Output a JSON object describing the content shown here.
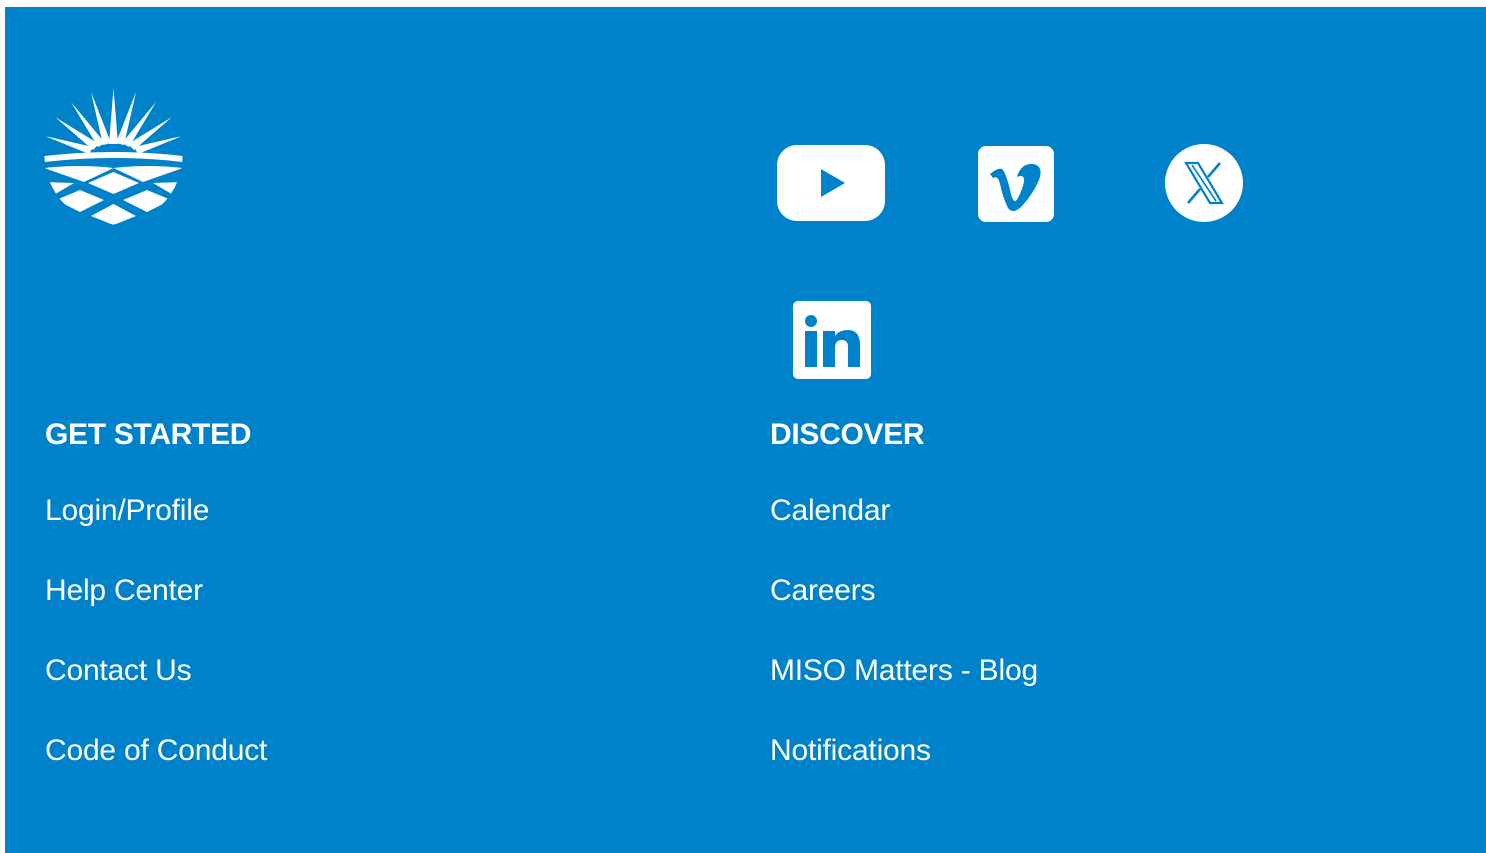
{
  "brand": {
    "background_color": "#0082ca",
    "logo_icon": "sunburst-logo-icon"
  },
  "social": [
    {
      "name": "youtube",
      "icon": "youtube-icon"
    },
    {
      "name": "vimeo",
      "icon": "vimeo-icon"
    },
    {
      "name": "x",
      "icon": "x-icon"
    },
    {
      "name": "linkedin",
      "icon": "linkedin-icon"
    }
  ],
  "get_started": {
    "heading": "GET STARTED",
    "links": [
      "Login/Profile",
      "Help Center",
      "Contact Us",
      "Code of Conduct"
    ]
  },
  "discover": {
    "heading": "DISCOVER",
    "links": [
      "Calendar",
      "Careers",
      "MISO Matters - Blog",
      "Notifications"
    ]
  }
}
